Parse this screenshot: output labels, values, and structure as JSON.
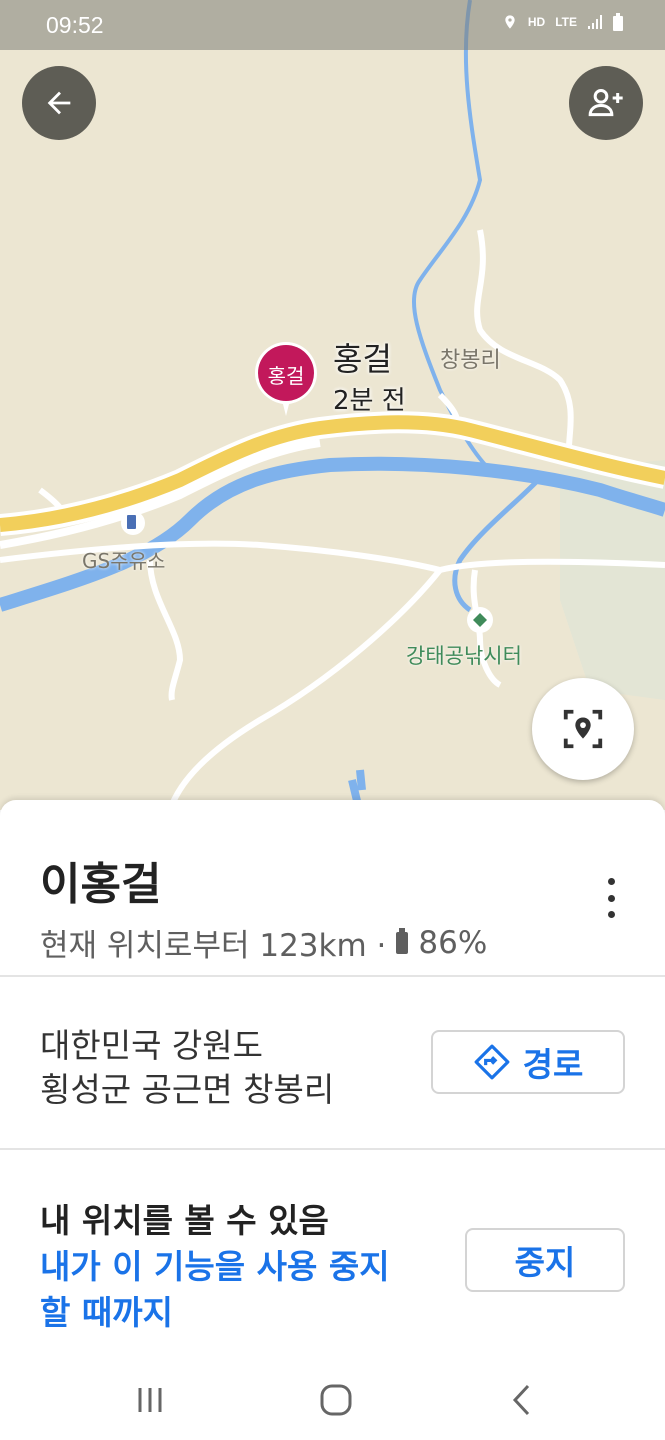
{
  "status_bar": {
    "time": "09:52",
    "icons": [
      "location-icon",
      "hd-voice-icon",
      "lte-icon",
      "signal-icon",
      "battery-icon"
    ],
    "hd_label": "HD",
    "lte_label": "LTE"
  },
  "map": {
    "marker_label": "홍걸",
    "person_label": "홍걸",
    "time_ago": "2분 전",
    "places": {
      "village": "창봉리",
      "gas_station": "GS주유소",
      "fishing": "강태공낚시터"
    }
  },
  "sheet": {
    "name": "이홍걸",
    "distance_text": "현재 위치로부터 123km ·",
    "battery": "86%",
    "address_line1": "대한민국 강원도",
    "address_line2": "횡성군 공근면 창봉리",
    "route_label": "경로",
    "share_title": "내 위치를 볼 수 있음",
    "share_until": "내가 이 기능을 사용 중지할 때까지",
    "stop_label": "중지"
  },
  "colors": {
    "accent": "#1a73e8",
    "marker": "#c2185b",
    "road": "#f2cf5b",
    "water": "#7fb2ec",
    "land": "#ece6d2"
  }
}
